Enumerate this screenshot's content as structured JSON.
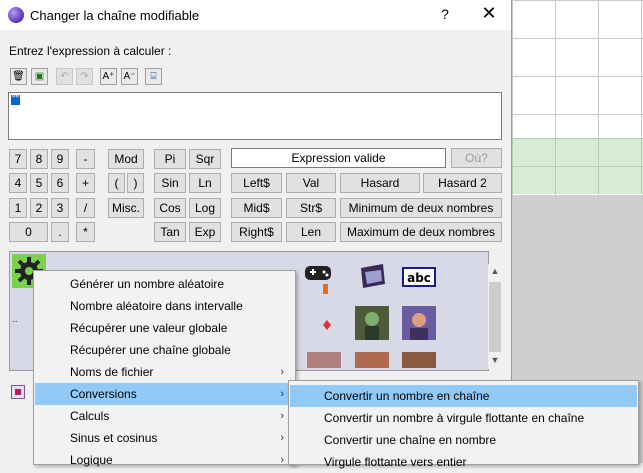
{
  "window": {
    "title": "Changer la chaîne modifiable",
    "help": "?",
    "close": "✕"
  },
  "prompt": "Entrez l'expression à calculer :",
  "toolbar": [
    {
      "name": "delete-icon",
      "glyph": "🗑"
    },
    {
      "name": "insert-icon",
      "glyph": "▣"
    },
    {
      "name": "undo-icon",
      "glyph": "↶"
    },
    {
      "name": "redo-icon",
      "glyph": "↷"
    },
    {
      "name": "font-larger-icon",
      "glyph": "A⁺"
    },
    {
      "name": "font-smaller-icon",
      "glyph": "A⁻"
    },
    {
      "name": "wrap-icon",
      "glyph": "⌸"
    }
  ],
  "expression": {
    "value": "\"\""
  },
  "keypad": {
    "row1": [
      "7",
      "8",
      "9",
      "-"
    ],
    "row2": [
      "4",
      "5",
      "6",
      "+"
    ],
    "row3": [
      "1",
      "2",
      "3",
      "/"
    ],
    "row4": [
      "0",
      ".",
      "*"
    ],
    "mod": "Mod",
    "paren_open": "(",
    "paren_close": ")",
    "misc": "Misc.",
    "pi": "Pi",
    "sqr": "Sqr",
    "sin": "Sin",
    "ln": "Ln",
    "cos": "Cos",
    "log": "Log",
    "tan": "Tan",
    "exp": "Exp",
    "left": "Left$",
    "val": "Val",
    "hasard": "Hasard",
    "hasard2": "Hasard 2",
    "mid": "Mid$",
    "str": "Str$",
    "min": "Minimum de deux nombres",
    "right": "Right$",
    "len": "Len",
    "max": "Maximum de deux nombres"
  },
  "status": "Expression valide",
  "where_button": "Où?",
  "palette": {
    "abc_label": "abc",
    "dots": ".."
  },
  "menu1": [
    {
      "label": "Générer un nombre aléatoire",
      "sub": false
    },
    {
      "label": "Nombre aléatoire dans intervalle",
      "sub": false
    },
    {
      "label": "Récupérer une valeur globale",
      "sub": false
    },
    {
      "label": "Récupérer une chaîne globale",
      "sub": false
    },
    {
      "label": "Noms de fichier",
      "sub": true
    },
    {
      "label": "Conversions",
      "sub": true
    },
    {
      "label": "Calculs",
      "sub": true
    },
    {
      "label": "Sinus et cosinus",
      "sub": true
    },
    {
      "label": "Logique",
      "sub": true
    }
  ],
  "menu1_highlight": 5,
  "menu2": [
    "Convertir un nombre en chaîne",
    "Convertir un nombre à virgule flottante en chaîne",
    "Convertir une chaîne en nombre",
    "Virgule flottante vers entier"
  ],
  "menu2_highlight": 0,
  "submenu_arrow": "›",
  "colors": {
    "highlight": "#91c9f7",
    "selection": "#0a64d8",
    "palette_bg": "#d7dae6"
  }
}
